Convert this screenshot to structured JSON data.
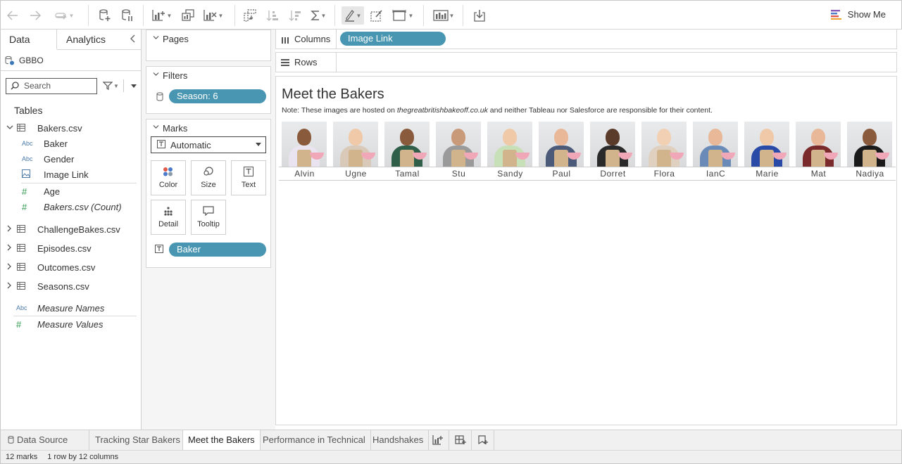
{
  "toolbar": {
    "show_me_label": "Show Me",
    "icons": [
      "back-arrow-icon",
      "forward-arrow-icon",
      "redo-icon",
      "new-datasource-icon",
      "pause-updates-icon",
      "new-worksheet-icon",
      "duplicate-sheet-icon",
      "clear-sheet-icon",
      "swap-icon",
      "sort-ascending-icon",
      "sort-descending-icon",
      "totals-icon",
      "highlight-icon",
      "label-icon",
      "fit-icon",
      "presentation-icon",
      "share-icon"
    ]
  },
  "data_pane": {
    "tabs": [
      "Data",
      "Analytics"
    ],
    "datasource": "GBBO",
    "search_placeholder": "Search",
    "tables_title": "Tables",
    "bakers_table": "Bakers.csv",
    "fields": [
      {
        "type": "Abc",
        "name": "Baker",
        "italic": false
      },
      {
        "type": "Abc",
        "name": "Gender",
        "italic": false
      },
      {
        "type": "image",
        "name": "Image Link",
        "italic": false
      },
      {
        "type": "#",
        "name": "Age",
        "italic": false
      },
      {
        "type": "#",
        "name": "Bakers.csv (Count)",
        "italic": true
      }
    ],
    "other_tables": [
      "ChallengeBakes.csv",
      "Episodes.csv",
      "Outcomes.csv",
      "Seasons.csv"
    ],
    "measures": [
      {
        "type": "Abc",
        "name": "Measure Names"
      },
      {
        "type": "#",
        "name": "Measure Values"
      }
    ]
  },
  "cards": {
    "pages_title": "Pages",
    "filters_title": "Filters",
    "filter_pill": "Season: 6",
    "marks_title": "Marks",
    "mark_type": "Automatic",
    "mark_buttons": [
      "Color",
      "Size",
      "Text",
      "Detail",
      "Tooltip"
    ],
    "text_pill": "Baker"
  },
  "shelves": {
    "columns_label": "Columns",
    "columns_pill": "Image Link",
    "rows_label": "Rows"
  },
  "view": {
    "title": "Meet the Bakers",
    "note_label": "Note:",
    "note_before": "These images are hosted on",
    "note_site": "thegreatbritishbakeoff.co.uk",
    "note_after": "and neither Tableau nor Salesforce are responsible for their content.",
    "bakers": [
      {
        "name": "Alvin",
        "skin": "#8a5a3c",
        "top": "#e9e4f0"
      },
      {
        "name": "Ugne",
        "skin": "#f0c9a8",
        "top": "#d9c9b8"
      },
      {
        "name": "Tamal",
        "skin": "#8a5a3c",
        "top": "#2f5f48"
      },
      {
        "name": "Stu",
        "skin": "#c89a7a",
        "top": "#9a9a9a"
      },
      {
        "name": "Sandy",
        "skin": "#f0c9a8",
        "top": "#c8e0b8"
      },
      {
        "name": "Paul",
        "skin": "#e8b898",
        "top": "#4a5a78"
      },
      {
        "name": "Dorret",
        "skin": "#5a3a28",
        "top": "#2a2a2a"
      },
      {
        "name": "Flora",
        "skin": "#f2d0b4",
        "top": "#e0d0c0"
      },
      {
        "name": "IanC",
        "skin": "#e8b898",
        "top": "#6a8ab8"
      },
      {
        "name": "Marie",
        "skin": "#f0c9a8",
        "top": "#2a4aa8"
      },
      {
        "name": "Mat",
        "skin": "#e8b898",
        "top": "#7a2a2a"
      },
      {
        "name": "Nadiya",
        "skin": "#8a5a3c",
        "top": "#1a1a1a"
      }
    ]
  },
  "sheet_tabs": {
    "data_source": "Data Source",
    "sheets": [
      "Tracking Star Bakers",
      "Meet the Bakers",
      "Performance in Technical",
      "Handshakes"
    ],
    "active": "Meet the Bakers"
  },
  "status": {
    "marks": "12 marks",
    "dims": "1 row by 12 columns"
  },
  "colors": {
    "pill": "#4996b2",
    "numeric_field": "#2e9a4e",
    "dimension_field": "#4a7aa8"
  }
}
